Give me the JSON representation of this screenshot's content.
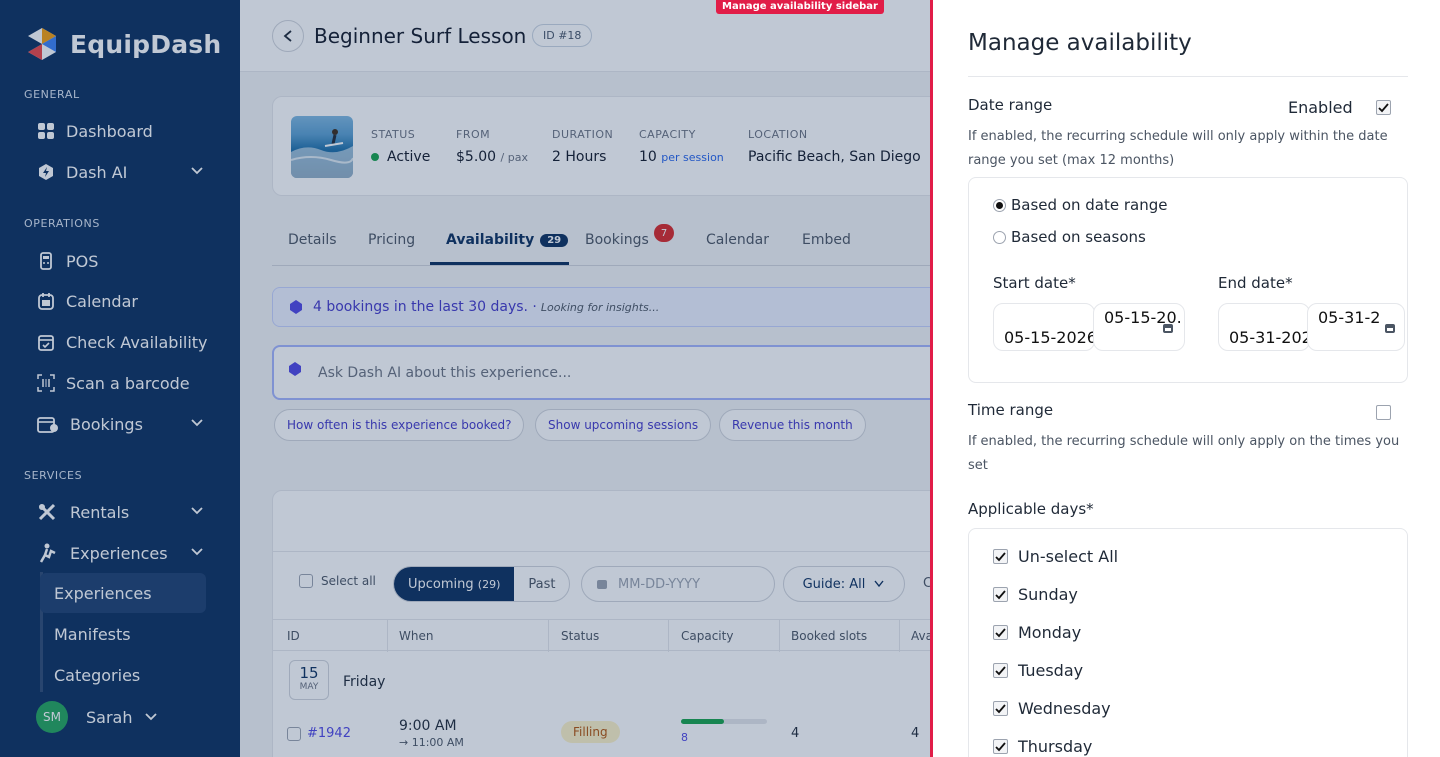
{
  "brand": {
    "name": "EquipDash",
    "colors": {
      "navy": "#0b2f5e",
      "accent": "#e11d48",
      "green": "#16a34a"
    }
  },
  "sidebar": {
    "sections": {
      "general": "GENERAL",
      "operations": "OPERATIONS",
      "services": "SERVICES"
    },
    "items": [
      {
        "label": "Dashboard",
        "icon": "grid-icon"
      },
      {
        "label": "Dash AI",
        "icon": "ai-shield-icon"
      },
      {
        "label": "POS",
        "icon": "pos-terminal-icon"
      },
      {
        "label": "Calendar",
        "icon": "calendar-icon"
      },
      {
        "label": "Check Availability",
        "icon": "calendar-check-icon"
      },
      {
        "label": "Scan a barcode",
        "icon": "barcode-scan-icon"
      },
      {
        "label": "Bookings",
        "icon": "bookings-icon"
      },
      {
        "label": "Rentals",
        "icon": "rentals-icon"
      },
      {
        "label": "Experiences",
        "icon": "experiences-icon"
      }
    ],
    "sub_items": [
      "Experiences",
      "Manifests",
      "Categories"
    ],
    "user": {
      "initials": "SM",
      "name": "Sarah"
    }
  },
  "header": {
    "title": "Beginner Surf Lesson",
    "id_badge": "ID #18"
  },
  "summary": {
    "status_label": "STATUS",
    "status_value": "Active",
    "from_label": "FROM",
    "from_value": "$5.00",
    "from_unit": "/ pax",
    "duration_label": "DURATION",
    "duration_value": "2 Hours",
    "capacity_label": "CAPACITY",
    "capacity_value": "10",
    "capacity_unit": "per session",
    "location_label": "LOCATION",
    "location_value": "Pacific Beach, San Diego"
  },
  "tabs": {
    "details": "Details",
    "pricing": "Pricing",
    "availability": "Availability",
    "availability_count": "29",
    "bookings": "Bookings",
    "bookings_count": "7",
    "calendar": "Calendar",
    "embed": "Embed"
  },
  "insight": {
    "text": "4 bookings in the last 30 days. ·",
    "muted": "Looking for insights..."
  },
  "ask": {
    "placeholder": "Ask Dash AI about this experience..."
  },
  "chips": [
    "How often is this experience booked?",
    "Show upcoming sessions",
    "Revenue this month"
  ],
  "table": {
    "select_all": "Select all",
    "upcoming": "Upcoming",
    "upcoming_count": "(29)",
    "past": "Past",
    "date_placeholder": "MM-DD-YYYY",
    "guide": "Guide: All",
    "more": "Cl",
    "headers": [
      "ID",
      "When",
      "Status",
      "Capacity",
      "Booked slots",
      "Avai"
    ],
    "day": {
      "num": "15",
      "month": "MAY",
      "name": "Friday"
    },
    "row": {
      "id": "#1942",
      "time": "9:00 AM",
      "end": "→ 11:00 AM",
      "status": "Filling",
      "capacity": "8",
      "capacity_fraction": 0.5,
      "booked": "4",
      "avail": "4"
    }
  },
  "annotation": "Manage availability sidebar",
  "panel": {
    "title": "Manage availability",
    "date_range": {
      "label": "Date range",
      "enabled_label": "Enabled",
      "enabled": true,
      "help": "If enabled, the recurring schedule will only apply within the date range you set (max 12 months)"
    },
    "radio_date": "Based on date range",
    "radio_seasons": "Based on seasons",
    "start_label": "Start date*",
    "start_value": "05-15-2026",
    "start_picker": "05-15-20.",
    "end_label": "End date*",
    "end_value": "05-31-202",
    "end_picker": "05-31-2",
    "time_range": {
      "label": "Time range",
      "help": "If enabled, the recurring schedule will only apply on the times you set"
    },
    "applicable_label": "Applicable days*",
    "days": [
      "Un-select All",
      "Sunday",
      "Monday",
      "Tuesday",
      "Wednesday",
      "Thursday"
    ]
  }
}
